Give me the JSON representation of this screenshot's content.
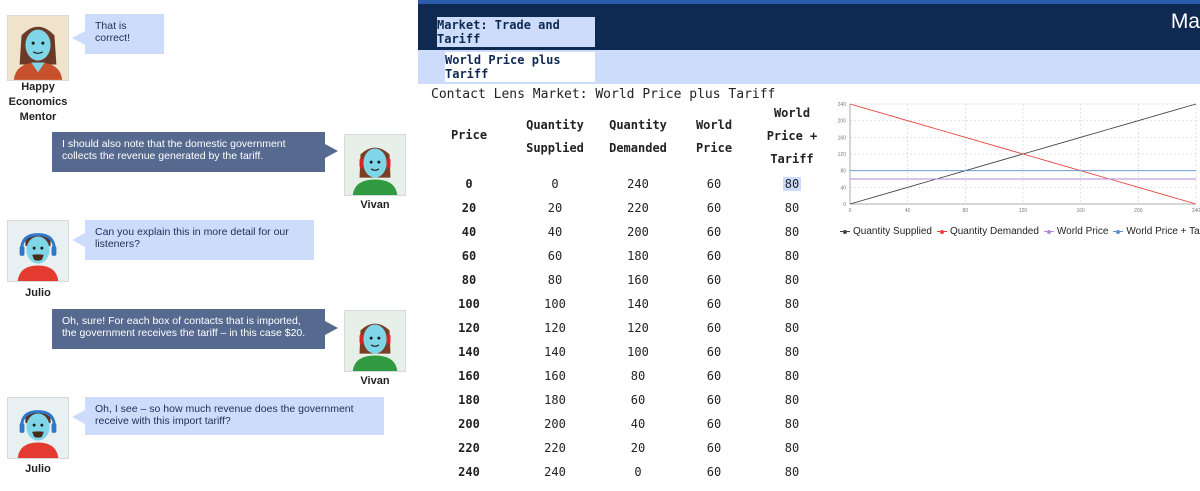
{
  "chat": {
    "messages": [
      {
        "speaker": "Happy Economics Mentor",
        "text": "That is correct!"
      },
      {
        "speaker": "Vivan",
        "text": "I should also note that the domestic government collects the revenue generated by the tariff."
      },
      {
        "speaker": "Julio",
        "text": "Can you explain this in more detail for our listeners?"
      },
      {
        "speaker": "Vivan",
        "text": "Oh, sure! For each box of contacts that is imported, the government receives the tariff – in this case $20."
      },
      {
        "speaker": "Julio",
        "text": "Oh, I see – so how much revenue does the government receive with this import tariff?"
      }
    ],
    "mentor_name_line1": "Happy",
    "mentor_name_line2": "Economics",
    "mentor_name_line3": "Mentor"
  },
  "app": {
    "brand": "Ma",
    "tab_primary": "Market: Trade and Tariff",
    "tab_secondary": "World Price plus Tariff",
    "heading": "Contact Lens Market: World Price plus Tariff"
  },
  "table": {
    "headers": {
      "price": "Price",
      "qs_1": "Quantity",
      "qs_2": "Supplied",
      "qd_1": "Quantity",
      "qd_2": "Demanded",
      "wp_1": "World",
      "wp_2": "Price",
      "wpt_1": "World",
      "wpt_2": "Price +",
      "wpt_3": "Tariff"
    },
    "rows": [
      [
        "0",
        "0",
        "240",
        "60",
        "80"
      ],
      [
        "20",
        "20",
        "220",
        "60",
        "80"
      ],
      [
        "40",
        "40",
        "200",
        "60",
        "80"
      ],
      [
        "60",
        "60",
        "180",
        "60",
        "80"
      ],
      [
        "80",
        "80",
        "160",
        "60",
        "80"
      ],
      [
        "100",
        "100",
        "140",
        "60",
        "80"
      ],
      [
        "120",
        "120",
        "120",
        "60",
        "80"
      ],
      [
        "140",
        "140",
        "100",
        "60",
        "80"
      ],
      [
        "160",
        "160",
        "80",
        "60",
        "80"
      ],
      [
        "180",
        "180",
        "60",
        "60",
        "80"
      ],
      [
        "200",
        "200",
        "40",
        "60",
        "80"
      ],
      [
        "220",
        "220",
        "20",
        "60",
        "80"
      ],
      [
        "240",
        "240",
        "0",
        "60",
        "80"
      ]
    ],
    "highlighted_cell": {
      "row": 0,
      "col": 4
    }
  },
  "chart_data": {
    "type": "line",
    "x": [
      0,
      20,
      40,
      60,
      80,
      100,
      120,
      140,
      160,
      180,
      200,
      220,
      240
    ],
    "xticks": [
      0,
      40,
      80,
      120,
      160,
      200,
      240
    ],
    "yticks": [
      0,
      40,
      80,
      120,
      160,
      200,
      240
    ],
    "xlim": [
      0,
      240
    ],
    "ylim": [
      0,
      240
    ],
    "grid": true,
    "legend_position": "bottom",
    "series": [
      {
        "name": "Quantity Supplied",
        "color": "#444444",
        "values": [
          0,
          20,
          40,
          60,
          80,
          100,
          120,
          140,
          160,
          180,
          200,
          220,
          240
        ]
      },
      {
        "name": "Quantity Demanded",
        "color": "#e8423a",
        "values": [
          240,
          220,
          200,
          180,
          160,
          140,
          120,
          100,
          80,
          60,
          40,
          20,
          0
        ]
      },
      {
        "name": "World Price",
        "color": "#b38ad8",
        "values": [
          60,
          60,
          60,
          60,
          60,
          60,
          60,
          60,
          60,
          60,
          60,
          60,
          60
        ]
      },
      {
        "name": "World Price + Tariff",
        "color": "#5b8fd6",
        "values": [
          80,
          80,
          80,
          80,
          80,
          80,
          80,
          80,
          80,
          80,
          80,
          80,
          80
        ]
      }
    ]
  }
}
